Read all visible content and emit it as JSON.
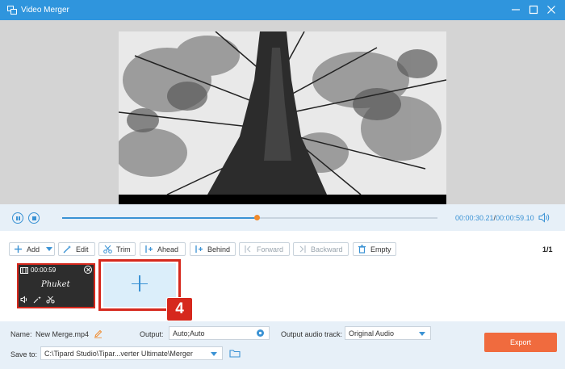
{
  "window": {
    "title": "Video Merger",
    "accent": "#2f95dd"
  },
  "player": {
    "progress": 0.52,
    "current_time": "00:00:30.21",
    "separator": "/",
    "total_time": "00:00:59.10"
  },
  "toolbar": {
    "add_label": "Add",
    "edit_label": "Edit",
    "trim_label": "Trim",
    "ahead_label": "Ahead",
    "behind_label": "Behind",
    "forward_label": "Forward",
    "backward_label": "Backward",
    "empty_label": "Empty",
    "page_count": "1/1"
  },
  "clips": [
    {
      "duration": "00:00:59",
      "title": "Phuket"
    }
  ],
  "annotation": {
    "step": "4",
    "color": "#d6281d"
  },
  "output": {
    "name_label": "Name:",
    "name_value": "New Merge.mp4",
    "output_label": "Output:",
    "output_value": "Auto;Auto",
    "audio_track_label": "Output audio track:",
    "audio_track_value": "Original Audio",
    "save_to_label": "Save to:",
    "save_to_value": "C:\\Tipard Studio\\Tipar...verter Ultimate\\Merger",
    "export_label": "Export",
    "export_color": "#f06b3e"
  }
}
